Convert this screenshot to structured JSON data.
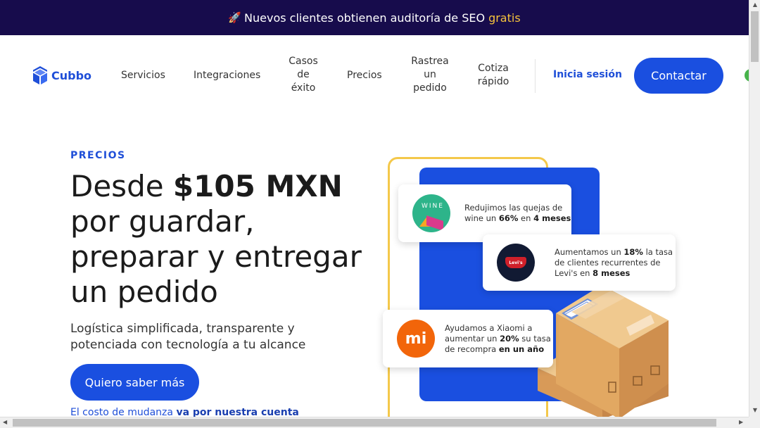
{
  "banner": {
    "icon": "rocket-icon",
    "rocket": "🚀",
    "text": "Nuevos clientes obtienen auditoría de SEO",
    "highlight": "gratis",
    "highlight_color": "#f6c33c",
    "background": "#170c4c"
  },
  "nav": {
    "logo_text": "Cubbo",
    "items": [
      {
        "label": "Servicios"
      },
      {
        "label": "Integraciones"
      },
      {
        "line1": "Casos",
        "line2": "de",
        "line3": "éxito"
      },
      {
        "label": "Precios"
      },
      {
        "line1": "Rastrea",
        "line2": "un",
        "line3": "pedido"
      },
      {
        "line1": "Cotiza",
        "line2": "rápido"
      }
    ],
    "login": "Inicia sesión",
    "contact": "Contactar",
    "accent": "#1a4fe0"
  },
  "hero": {
    "eyebrow": "PRECIOS",
    "headline_pre": "Desde ",
    "headline_price": "$105 MXN",
    "headline_rest": "por guardar, preparar y entregar un pedido",
    "subhead": "Logística simplificada, transparente y potenciada con tecnología a tu alcance",
    "cta": "Quiero saber más",
    "moving_pre": "El costo de mudanza ",
    "moving_bold": "va por nuestra cuenta"
  },
  "cards": {
    "wine": {
      "logo": "WINE",
      "l1": "Redujimos las quejas de",
      "l2a": "wine un ",
      "l2b": "66%",
      "l2c": " en ",
      "l2d": "4 meses"
    },
    "levis": {
      "logo": "Levi's",
      "l1a": "Aumentamos un ",
      "l1b": "18%",
      "l1c": " la tasa",
      "l2": "de clientes recurrentes de",
      "l3a": "Levi's en ",
      "l3b": "8 meses"
    },
    "xiaomi": {
      "logo": "mi",
      "l1": "Ayudamos a Xiaomi a",
      "l2a": "aumentar un ",
      "l2b": "20%",
      "l2c": " su tasa",
      "l3a": "de recompra ",
      "l3b": "en un año"
    }
  }
}
